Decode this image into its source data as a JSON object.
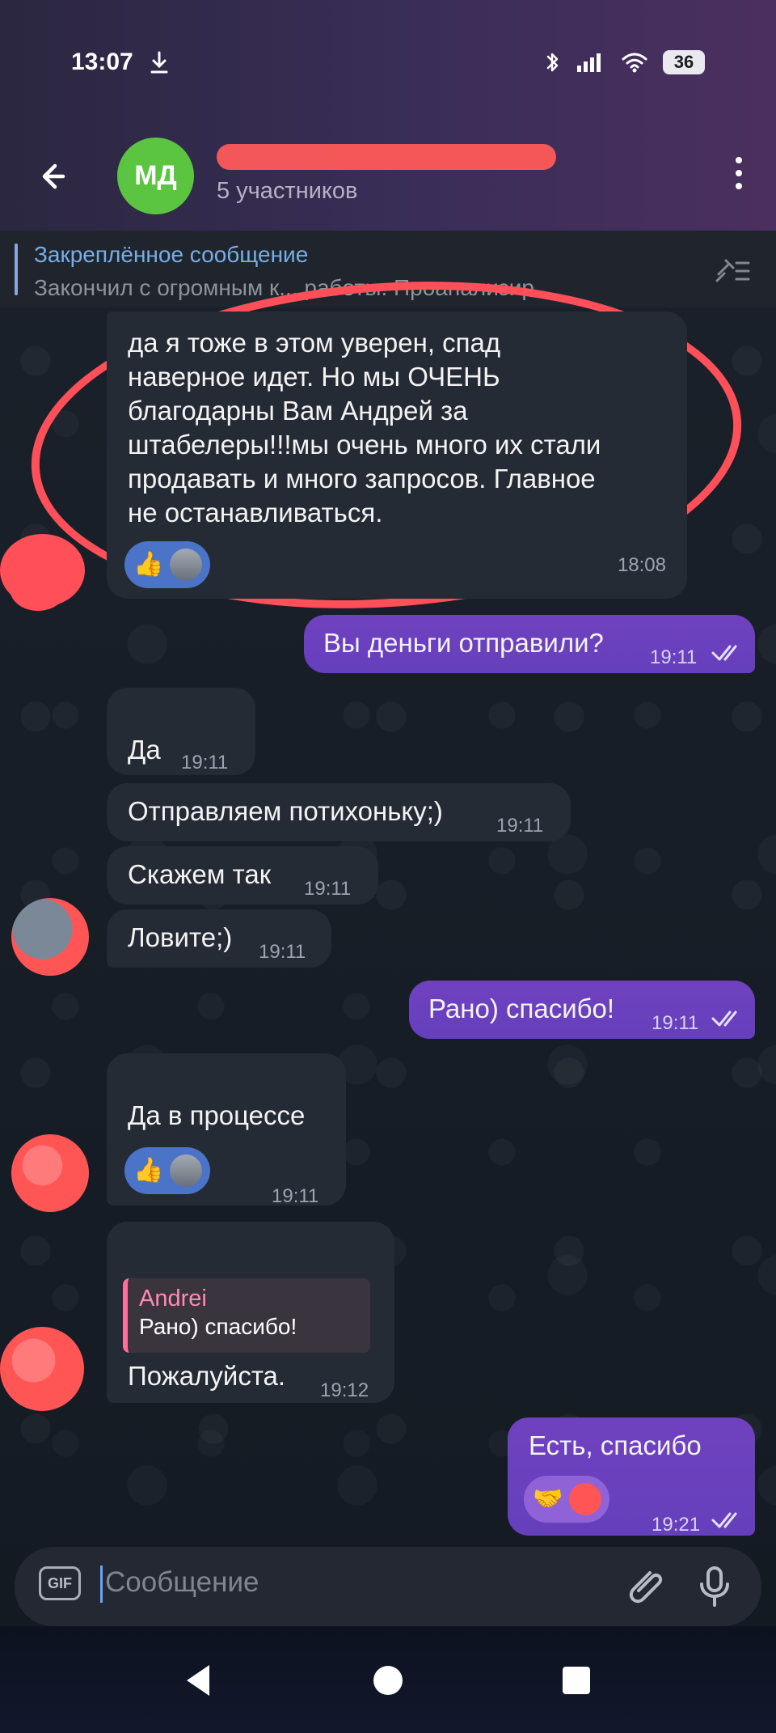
{
  "status": {
    "time": "13:07",
    "battery": "36"
  },
  "chat": {
    "avatar_initials": "МД",
    "participants": "5 участников"
  },
  "pinned": {
    "title": "Закреплённое сообщение",
    "text": "Закончил с огромным к... работы. Проанализир..."
  },
  "messages": {
    "m1": {
      "lines": [
        "да я тоже в этом уверен, спад",
        "наверное идет. Но мы ОЧЕНЬ",
        "благодарны Вам Андрей за",
        "штабелеры!!!мы очень много их стали",
        "продавать и много запросов. Главное",
        "не останавливаться."
      ],
      "time": "18:08"
    },
    "m2": {
      "text": "Вы деньги отправили?",
      "time": "19:11"
    },
    "m3": {
      "text": "Да",
      "time": "19:11"
    },
    "m4": {
      "text": "Отправляем потихоньку;)",
      "time": "19:11"
    },
    "m5": {
      "text": "Скажем так",
      "time": "19:11"
    },
    "m6": {
      "text": "Ловите;)",
      "time": "19:11"
    },
    "m7": {
      "text": "Рано) спасибо!",
      "time": "19:11"
    },
    "m8": {
      "text": "Да в процессе",
      "time": "19:11"
    },
    "m9": {
      "reply_name": "Andrei",
      "reply_text": "Рано) спасибо!",
      "text": "Пожалуйста.",
      "time": "19:12"
    },
    "m10": {
      "text": "Есть, спасибо",
      "time": "19:21"
    }
  },
  "input": {
    "gif": "GIF",
    "placeholder": "Сообщение"
  },
  "icons": {
    "thumbs": "👍",
    "handshake": "🤝"
  }
}
